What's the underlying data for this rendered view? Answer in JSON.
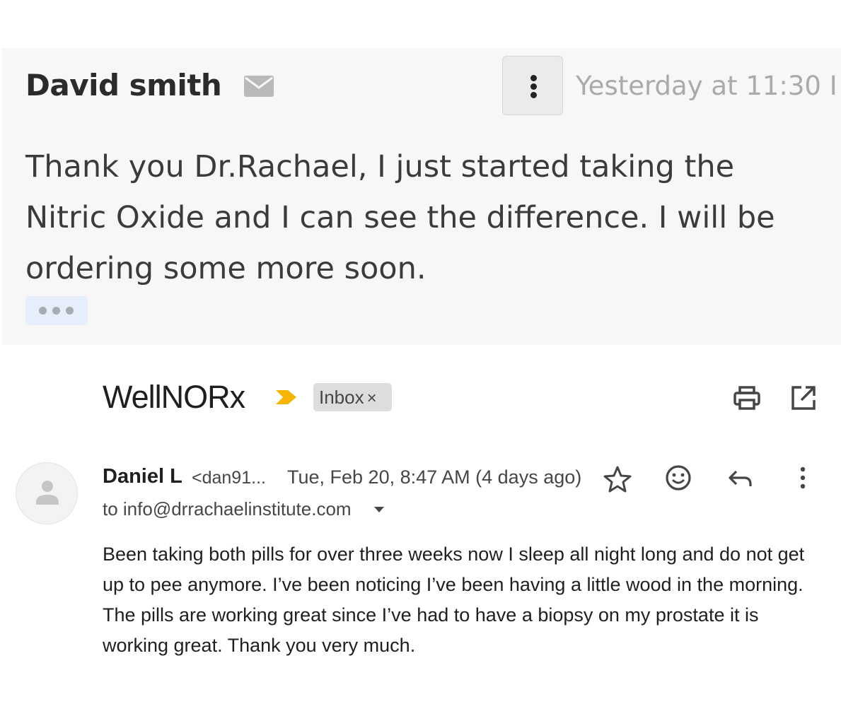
{
  "top_email": {
    "sender": "David smith",
    "timestamp": "Yesterday at 11:30 I",
    "body": "Thank you Dr.Rachael, I just started taking the Nitric Oxide and I can see the difference. I will be ordering some more soon."
  },
  "thread": {
    "subject": "WellNORx",
    "label": "Inbox",
    "label_remove": "×",
    "importance_color": "#f4b400"
  },
  "message": {
    "sender_name": "Daniel L",
    "sender_email": "<dan91...",
    "date": "Tue, Feb 20, 8:47 AM (4 days ago)",
    "recipient": "to info@drrachaelinstitute.com",
    "body": "Been taking both pills for over three weeks now I sleep all night long and do not get up to pee anymore. I’ve been noticing I’ve been having a little wood in the morning. The pills are working great since I’ve had to have a biopsy on my prostate it is working great. Thank you very much."
  },
  "icons": {
    "mail": "envelope-icon",
    "more": "more-vertical-icon",
    "star": "star-icon",
    "emoji": "smiley-icon",
    "reply": "reply-icon",
    "print": "print-icon",
    "open": "open-in-new-window-icon",
    "avatar": "person-icon"
  }
}
